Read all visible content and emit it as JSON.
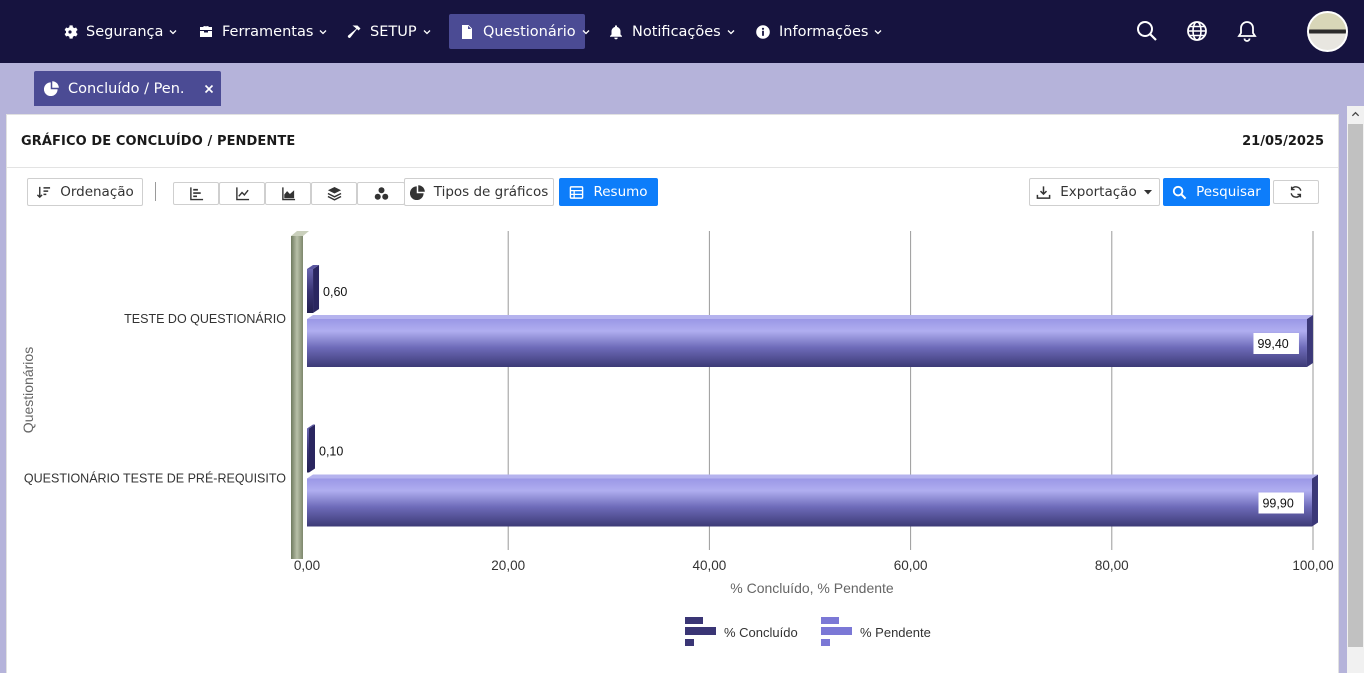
{
  "nav": {
    "items": [
      {
        "label": "Segurança",
        "icon": "gear-icon"
      },
      {
        "label": "Ferramentas",
        "icon": "toolbox-icon"
      },
      {
        "label": "SETUP",
        "icon": "hammer-icon"
      },
      {
        "label": "Questionário",
        "icon": "document-icon",
        "active": true
      },
      {
        "label": "Notificações",
        "icon": "bell-icon"
      },
      {
        "label": "Informações",
        "icon": "info-icon"
      }
    ],
    "right_icons": [
      "search-icon",
      "globe-icon",
      "bell-icon"
    ]
  },
  "tab": {
    "label": "Concluído / Pen...",
    "icon": "pie-chart-icon"
  },
  "panel": {
    "title": "GRÁFICO DE CONCLUÍDO / PENDENTE",
    "date": "21/05/2025"
  },
  "toolbar": {
    "sort_label": "Ordenação",
    "chart_types_label": "Tipos de gráficos",
    "summary_label": "Resumo",
    "export_label": "Exportação",
    "search_label": "Pesquisar"
  },
  "colors": {
    "nav_bg": "#16133f",
    "accent": "#4b4b94",
    "primary_button": "#0d7dfa",
    "series_concluido": "#3a3575",
    "series_pendente": "#7b78d6"
  },
  "chart_data": {
    "type": "bar",
    "orientation": "horizontal",
    "categories": [
      "TESTE DO QUESTIONÁRIO",
      "QUESTIONÁRIO TESTE DE PRÉ-REQUISITO"
    ],
    "series": [
      {
        "name": "% Concluído",
        "values": [
          0.6,
          0.1
        ],
        "labels": [
          "0,60",
          "0,10"
        ]
      },
      {
        "name": "% Pendente",
        "values": [
          99.4,
          99.9
        ],
        "labels": [
          "99,40",
          "99,90"
        ]
      }
    ],
    "xlabel": "% Concluído, % Pendente",
    "ylabel": "Questionários",
    "xlim": [
      0,
      100
    ],
    "ticks": [
      0,
      20,
      40,
      60,
      80,
      100
    ],
    "tick_labels": [
      "0,00",
      "20,00",
      "40,00",
      "60,00",
      "80,00",
      "100,00"
    ],
    "grid": true,
    "legend": "bottom"
  }
}
